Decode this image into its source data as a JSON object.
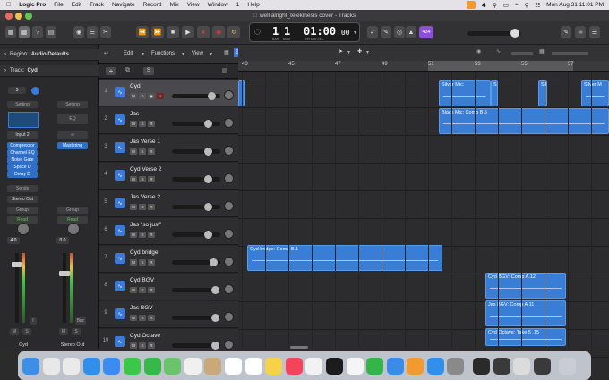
{
  "menubar": {
    "app": "Logic Pro",
    "items": [
      "File",
      "Edit",
      "Track",
      "Navigate",
      "Record",
      "Mix",
      "View",
      "Window",
      "1",
      "Help"
    ],
    "datetime": "Mon Aug 31  11:01 PM"
  },
  "window": {
    "title": "well alright_telekinesis cover - Tracks"
  },
  "toolbar": {
    "lcd_bar": "1",
    "lcd_beat": "1",
    "lcd_bar_label": "BAR",
    "lcd_beat_label": "BEAT",
    "lcd_time": "01:00",
    "lcd_time_frac": ":00",
    "lcd_time_label": "HR MIN SEC",
    "counter_badge": "434"
  },
  "inspector": {
    "region_label": "Region:",
    "region_value": "Audio Defaults",
    "track_label": "Track:",
    "track_value": "Cyd",
    "strip1": {
      "setting": "Setting",
      "input": "Input 2",
      "plugins": [
        "Compressor",
        "Channel EQ",
        "Noise Gate",
        "Space D",
        "Delay D"
      ],
      "sends": "Sends",
      "output": "Stereo Out",
      "group": "Group",
      "automation": "Read",
      "volume": "4.0",
      "name": "Cyd",
      "m": "M",
      "s": "S",
      "i": "I"
    },
    "strip2": {
      "setting": "Setting",
      "eq": "EQ",
      "plugin": "Mastering",
      "group": "Group",
      "automation": "Read",
      "volume": "0.0",
      "name": "Stereo Out",
      "m": "M",
      "s": "S",
      "bnc": "Bnc"
    }
  },
  "tracklist": {
    "header_edit": "Edit",
    "header_functions": "Functions",
    "header_view": "View",
    "tracks": [
      {
        "num": "1",
        "name": "Cyd"
      },
      {
        "num": "2",
        "name": "Jas"
      },
      {
        "num": "3",
        "name": "Jas Verse 1"
      },
      {
        "num": "4",
        "name": "Cyd Verse 2"
      },
      {
        "num": "5",
        "name": "Jas Verse 2"
      },
      {
        "num": "6",
        "name": "Jas \"so just\""
      },
      {
        "num": "7",
        "name": "Cyd bridge"
      },
      {
        "num": "8",
        "name": "Cyd BGV"
      },
      {
        "num": "9",
        "name": "Jas BGV"
      },
      {
        "num": "10",
        "name": "Cyd Octave"
      }
    ],
    "m": "M",
    "s": "S",
    "r": "R"
  },
  "ruler": {
    "bars": [
      "43",
      "45",
      "47",
      "49",
      "51",
      "53",
      "55",
      "57"
    ]
  },
  "regions": [
    {
      "label": "Silver Mic:"
    },
    {
      "label": "Silver M"
    },
    {
      "label": "Silver M"
    },
    {
      "label": "Silver M"
    },
    {
      "label": "Black Mic: Comp B.5"
    },
    {
      "label": "Cyd bridge: Comp B.1"
    },
    {
      "label": "Cyd BGV: Comp A.12"
    },
    {
      "label": "Jas BGV: Comp A.11"
    },
    {
      "label": "Cyd Octave: Take 5 .15"
    }
  ],
  "colors": {
    "region": "#3a7dd4",
    "accent": "#3b7ad6",
    "record": "#e03a3a",
    "badge": "#8c4fd6"
  }
}
